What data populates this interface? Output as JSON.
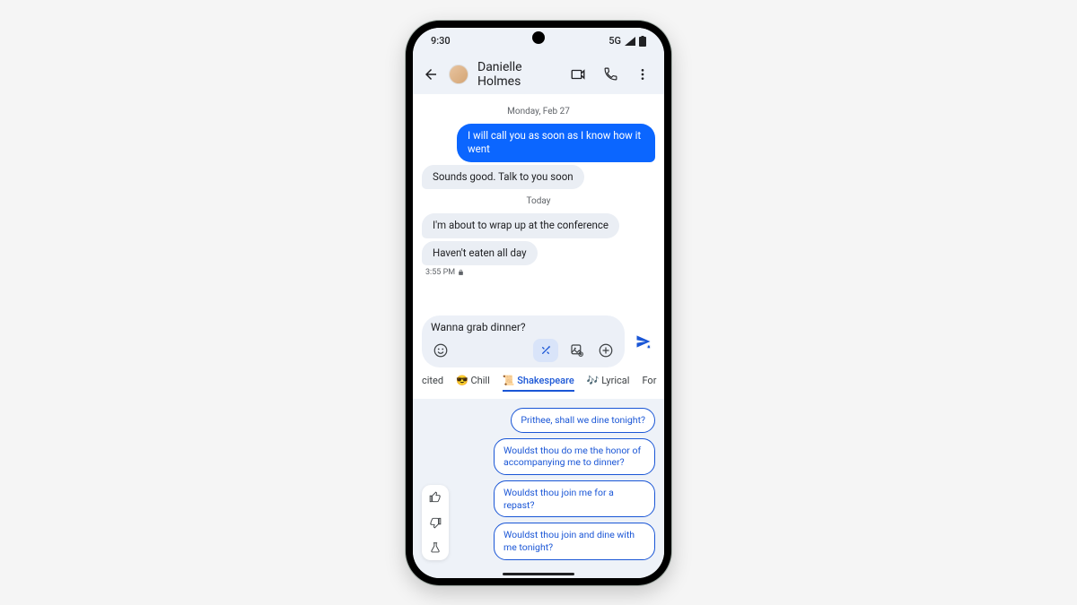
{
  "status": {
    "time": "9:30",
    "network": "5G"
  },
  "header": {
    "contact_name": "Danielle Holmes"
  },
  "chat": {
    "divider1": "Monday, Feb 27",
    "msg1": "I will call you as soon as I know how it went",
    "msg2": "Sounds good. Talk to you soon",
    "divider2": "Today",
    "msg3": "I'm about to wrap up at the conference",
    "msg4": "Haven't eaten all day",
    "ts1": "3:55 PM"
  },
  "compose": {
    "draft": "Wanna grab dinner?"
  },
  "style_tabs": {
    "t0": "cited",
    "t1_emoji": "😎",
    "t1": "Chill",
    "t2_emoji": "📜",
    "t2": "Shakespeare",
    "t3_emoji": "🎶",
    "t3": "Lyrical",
    "t4": "For"
  },
  "suggestions": {
    "s1": "Prithee, shall we dine tonight?",
    "s2": "Wouldst thou do me the honor of accompanying me to dinner?",
    "s3": "Wouldst thou join me for a repast?",
    "s4": "Wouldst thou join and dine with me tonight?"
  }
}
